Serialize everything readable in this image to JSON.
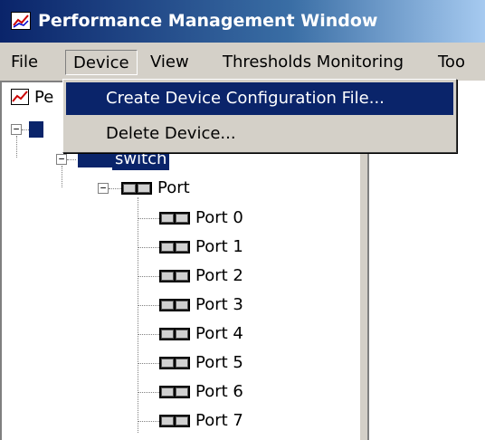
{
  "window": {
    "title": "Performance Management Window",
    "icon": "performance-chart-icon"
  },
  "menubar": {
    "items": [
      "File",
      "Device",
      "View",
      "Thresholds Monitoring",
      "Too"
    ]
  },
  "device_menu": {
    "items": [
      "Create Device Configuration File...",
      "Delete Device..."
    ]
  },
  "tree": {
    "root_label": "Pe",
    "switch_label": "switch",
    "port_group_label": "Port",
    "ports": [
      "Port 0",
      "Port 1",
      "Port 2",
      "Port 3",
      "Port 4",
      "Port 5",
      "Port 6",
      "Port 7"
    ]
  },
  "colors": {
    "selection": "#0a246a",
    "face": "#d4d0c8",
    "title_start": "#0a246a"
  }
}
